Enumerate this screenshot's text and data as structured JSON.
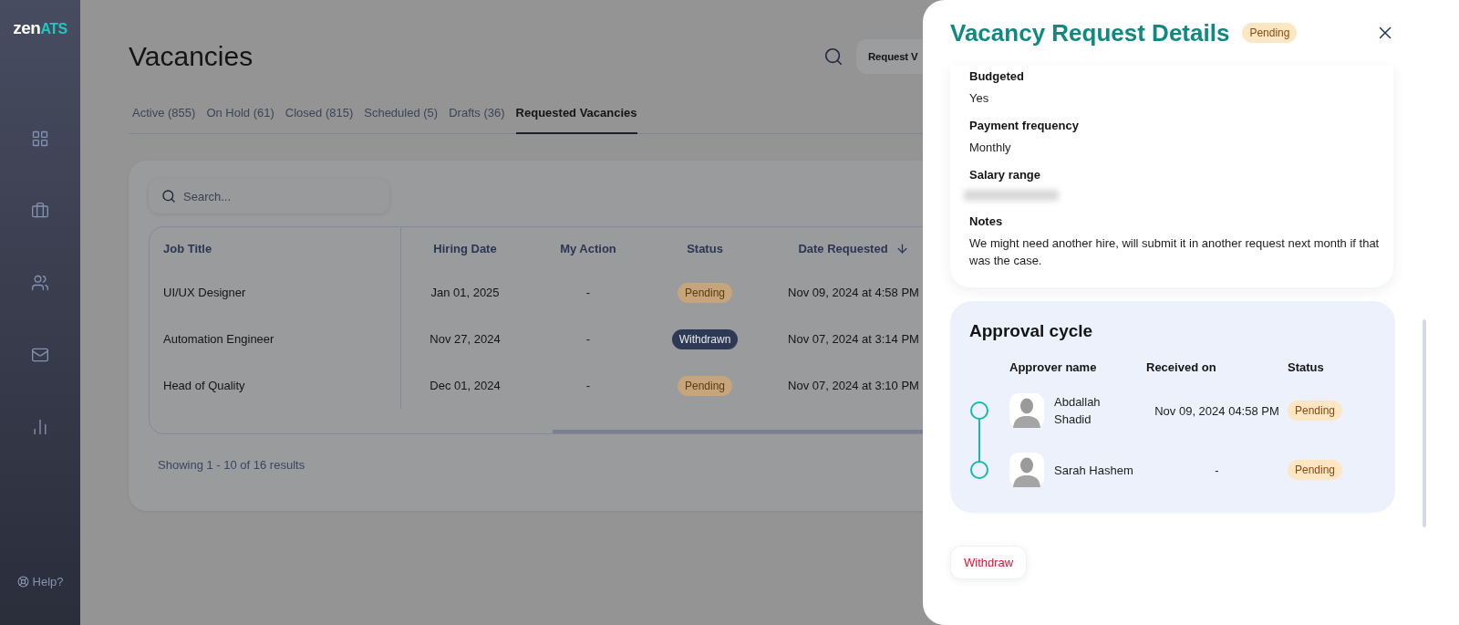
{
  "logo": {
    "text": "zen",
    "accent": "ATS"
  },
  "sidebar": {
    "items": [
      {
        "kind": "grid"
      },
      {
        "kind": "briefcase"
      },
      {
        "kind": "users"
      },
      {
        "kind": "mail"
      },
      {
        "kind": "chart"
      }
    ],
    "help": "Help?"
  },
  "page": {
    "title": "Vacancies",
    "action_button": "Request V"
  },
  "tabs": [
    {
      "label": "Active (855)",
      "selected": false
    },
    {
      "label": "On Hold (61)",
      "selected": false
    },
    {
      "label": "Closed (815)",
      "selected": false
    },
    {
      "label": "Scheduled (5)",
      "selected": false
    },
    {
      "label": "Drafts (36)",
      "selected": false
    },
    {
      "label": "Requested Vacancies",
      "selected": true
    }
  ],
  "search": {
    "placeholder": "Search..."
  },
  "table": {
    "columns": [
      "Job Title",
      "Hiring Date",
      "My Action",
      "Status",
      "Date Requested"
    ],
    "rows": [
      {
        "job_title": "UI/UX Designer",
        "hiring_date": "Jan 01, 2025",
        "my_action": "-",
        "status": {
          "label": "Pending",
          "kind": "pending"
        },
        "date_requested": "Nov 09, 2024 at 4:58 PM"
      },
      {
        "job_title": "Automation Engineer",
        "hiring_date": "Nov 27, 2024",
        "my_action": "-",
        "status": {
          "label": "Withdrawn",
          "kind": "withdrawn"
        },
        "date_requested": "Nov 07, 2024 at 3:14 PM"
      },
      {
        "job_title": "Head of Quality",
        "hiring_date": "Dec 01, 2024",
        "my_action": "-",
        "status": {
          "label": "Pending",
          "kind": "pending"
        },
        "date_requested": "Nov 07, 2024 at 3:10 PM"
      }
    ]
  },
  "pagination": "Showing 1 - 10 of 16 results",
  "panel": {
    "title": "Vacancy Request Details",
    "status": {
      "label": "Pending",
      "kind": "pending"
    },
    "fields": [
      {
        "label": "Budgeted",
        "value": "Yes"
      },
      {
        "label": "Payment frequency",
        "value": "Monthly"
      },
      {
        "label": "Salary range",
        "redacted": true
      },
      {
        "label": "Notes",
        "value": "We might need another hire, will submit it in another request next month if that was the case."
      }
    ],
    "approval": {
      "title": "Approval cycle",
      "columns": [
        "Approver name",
        "Received on",
        "Status"
      ],
      "approvers": [
        {
          "name": "Abdallah Shadid",
          "received_on": "Nov 09, 2024 04:58 PM",
          "status": {
            "label": "Pending",
            "kind": "pending"
          }
        },
        {
          "name": "Sarah Hashem",
          "received_on": "-",
          "status": {
            "label": "Pending",
            "kind": "pending"
          }
        }
      ]
    },
    "withdraw_button": "Withdraw"
  }
}
